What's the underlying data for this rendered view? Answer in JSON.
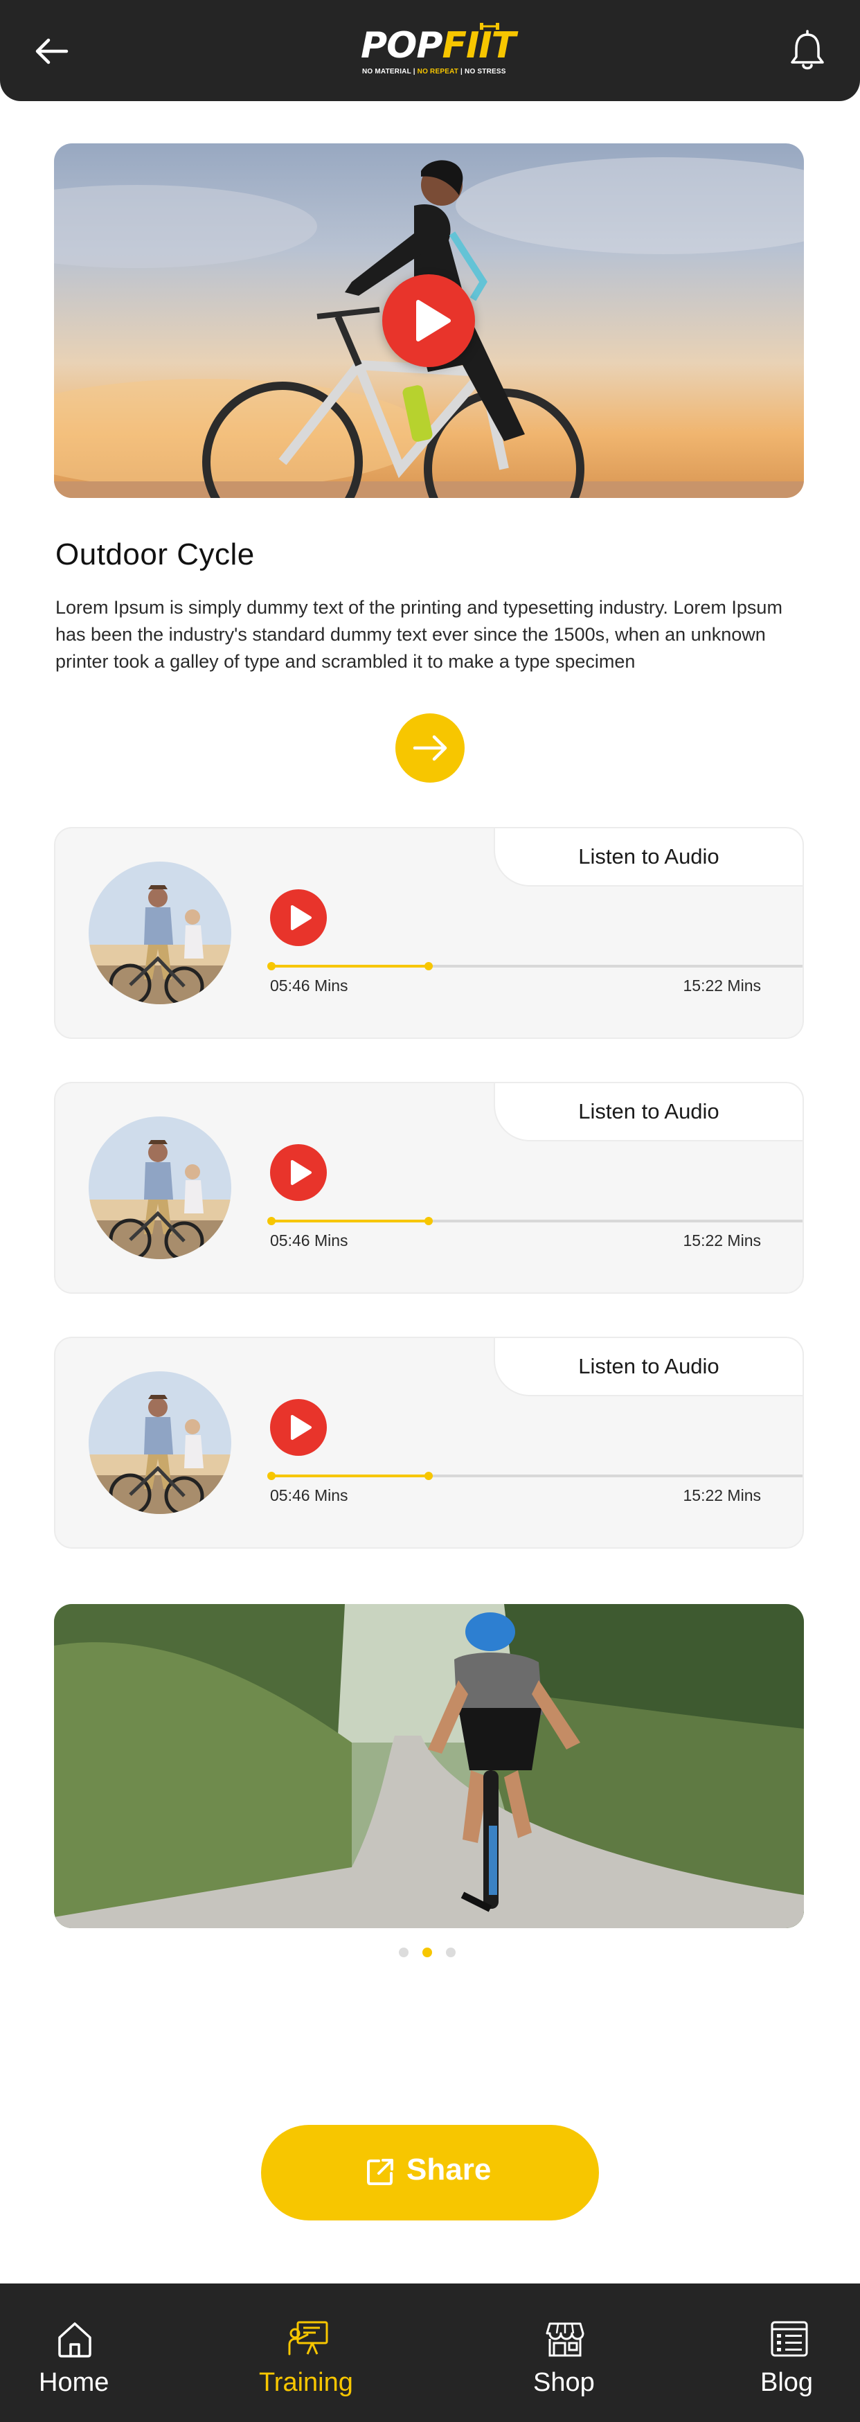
{
  "header": {
    "logo_text_a": "POP",
    "logo_text_b": "FIIT",
    "logo_tag_a": "NO MATERIAL | ",
    "logo_tag_b": "NO REPEAT",
    "logo_tag_c": " | NO STRESS"
  },
  "workout": {
    "title": "Outdoor Cycle",
    "description": "Lorem Ipsum is simply dummy text of the printing and typesetting industry. Lorem Ipsum has been the industry's standard dummy text ever since the 1500s, when an unknown printer took a galley of type and scrambled it to make a type specimen"
  },
  "audio_cards": [
    {
      "tab_label": "Listen to Audio",
      "current_time": "05:46 Mins",
      "total_time": "15:22 Mins",
      "progress": 0.29
    },
    {
      "tab_label": "Listen to Audio",
      "current_time": "05:46 Mins",
      "total_time": "15:22 Mins",
      "progress": 0.29
    },
    {
      "tab_label": "Listen to Audio",
      "current_time": "05:46 Mins",
      "total_time": "15:22 Mins",
      "progress": 0.29
    }
  ],
  "carousel": {
    "page_count": 3,
    "active_index": 1
  },
  "share": {
    "label": "Share",
    "icon": "external-link-icon"
  },
  "nav": {
    "items": [
      {
        "label": "Home",
        "icon": "home-icon"
      },
      {
        "label": "Training",
        "icon": "training-board-icon"
      },
      {
        "label": "Shop",
        "icon": "shop-icon"
      },
      {
        "label": "Blog",
        "icon": "blog-icon"
      }
    ],
    "active_index": 1
  },
  "colors": {
    "accent": "#f7c600",
    "play": "#e8342b",
    "dark": "#252525"
  }
}
